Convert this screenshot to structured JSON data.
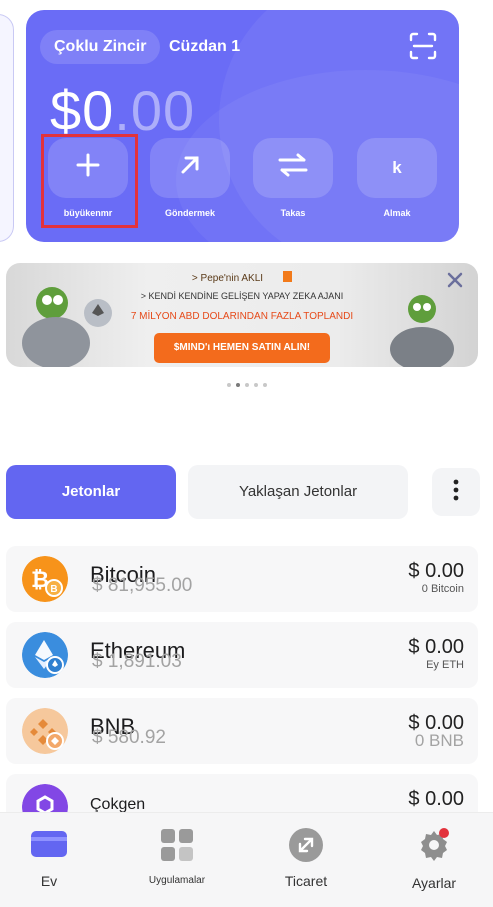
{
  "header": {
    "network": "Çoklu Zincir",
    "wallet_name": "Cüzdan 1",
    "balance_main": "$0",
    "balance_decimals": ".00"
  },
  "actions": [
    {
      "label": "büyükenmr",
      "icon": "plus-icon"
    },
    {
      "label": "Göndermek",
      "icon": "arrow-up-right-icon"
    },
    {
      "label": "Takas",
      "icon": "swap-arrows-icon"
    },
    {
      "label": "Almak",
      "icon": "k-letter-icon",
      "glyph": "k"
    }
  ],
  "banner": {
    "line1": "> Pepe'nin AKLI",
    "line2": "> KENDİ KENDİNE GELİŞEN YAPAY ZEKA AJANI",
    "line3": "7 MİLYON ABD DOLARINDAN FAZLA TOPLANDI",
    "cta": "$MIND'ı HEMEN SATIN ALIN!",
    "accent": "#f36b1c"
  },
  "carousel": {
    "count": 5,
    "active": 1
  },
  "tabs": {
    "active": "Jetonlar",
    "other": "Yaklaşan Jetonlar"
  },
  "tokens": [
    {
      "name": "Bitcoin",
      "price": "$ 81,955.00",
      "amount": "$ 0.00",
      "holding": "0 Bitcoin",
      "color": "#f7931a"
    },
    {
      "name": "Ethereum",
      "price": "$ 1,891.03",
      "amount": "$ 0.00",
      "holding": "Ey ETH",
      "color": "#3a8dde"
    },
    {
      "name": "BNB",
      "price": "$ 580.92",
      "amount": "$ 0.00",
      "holding": "0 BNB",
      "color": "#f0b90b"
    },
    {
      "name": "Çokgen",
      "price": "",
      "amount": "$ 0.00",
      "holding": "",
      "color": "#8247e5"
    }
  ],
  "nav": [
    {
      "label": "Ev",
      "icon": "wallet-icon",
      "active": true
    },
    {
      "label": "Uygulamalar",
      "icon": "apps-grid-icon"
    },
    {
      "label": "Ticaret",
      "icon": "trade-icon"
    },
    {
      "label": "Ayarlar",
      "icon": "gear-icon"
    }
  ],
  "colors": {
    "primary": "#6366f1",
    "card": "#6a6cf6",
    "alert": "#e2323c"
  }
}
